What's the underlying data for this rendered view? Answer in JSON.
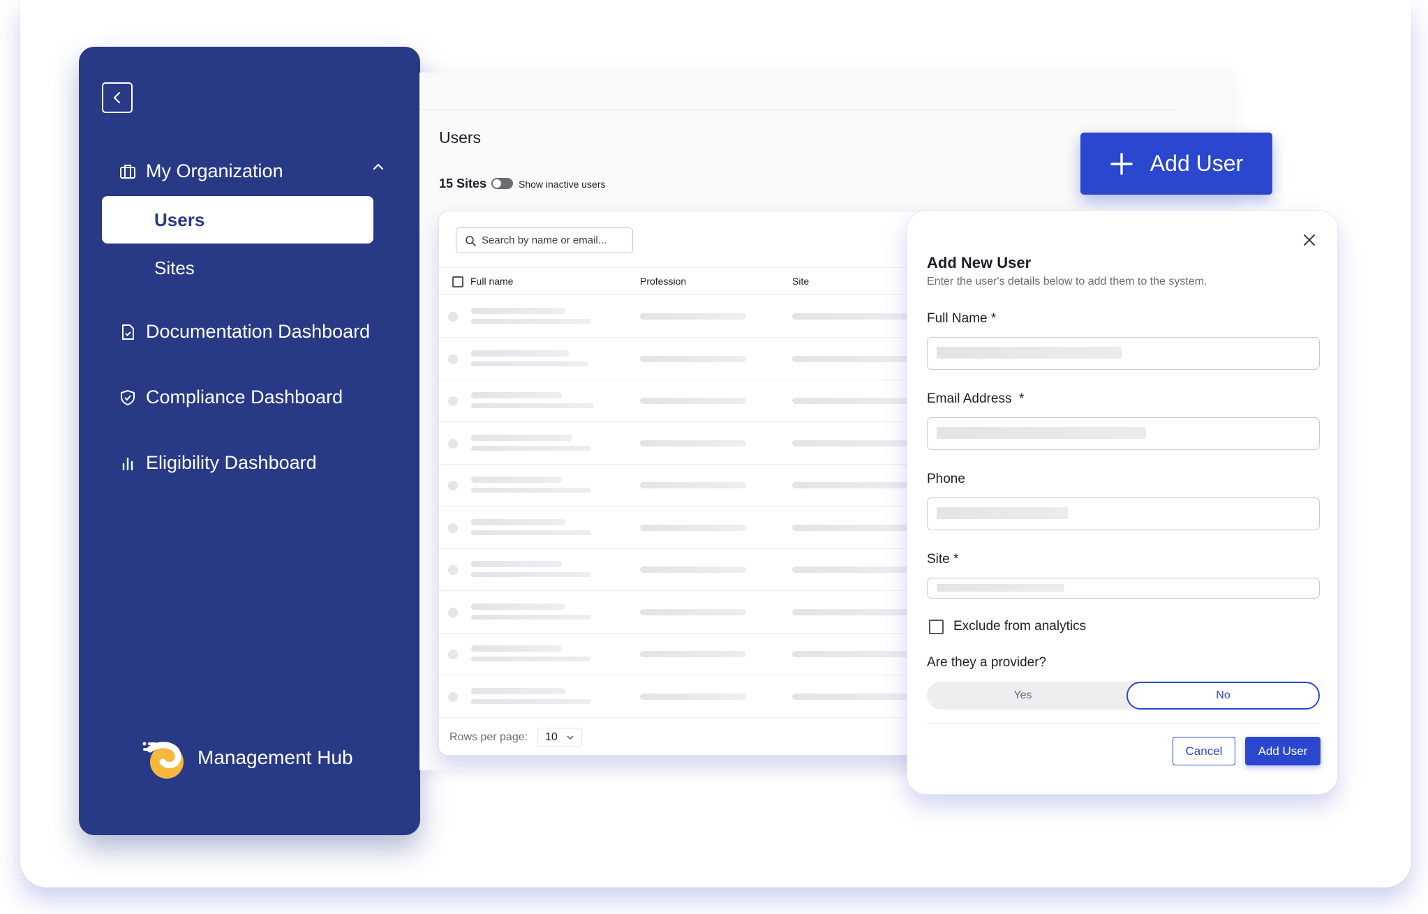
{
  "sidebar": {
    "nav": {
      "my_organization": "My Organization",
      "users": "Users",
      "sites": "Sites",
      "documentation": "Documentation Dashboard",
      "compliance": "Compliance Dashboard",
      "eligibility": "Eligibility Dashboard"
    },
    "brand_name": "Management Hub"
  },
  "main": {
    "title": "Users",
    "sites_count": "15 Sites",
    "toggle_label": "Show inactive users",
    "search_placeholder": "Search by name or email...",
    "columns": [
      "Full name",
      "Profession",
      "Site"
    ],
    "pager_label": "Rows per page:",
    "rows_per_page": "10"
  },
  "add_user_button": "Add User",
  "modal": {
    "title": "Add New User",
    "subtitle": "Enter the user's details below to add them to the system.",
    "full_name_label": "Full Name *",
    "email_label": "Email Address  *",
    "phone_label": "Phone",
    "site_label": "Site *",
    "exclude_label": "Exclude from analytics",
    "provider_question": "Are they a provider?",
    "yes": "Yes",
    "no": "No",
    "cancel": "Cancel",
    "submit": "Add User"
  },
  "colors": {
    "sidebar_bg": "#283a86",
    "accent": "#2b47cf"
  }
}
